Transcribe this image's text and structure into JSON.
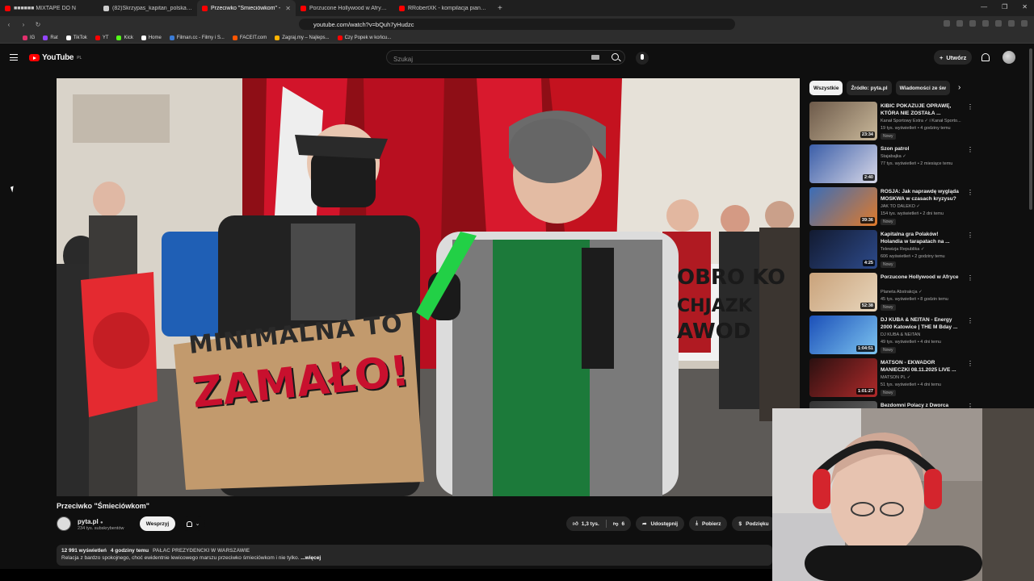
{
  "browser": {
    "tabs": [
      {
        "title": "■■■■■■ MIXTAPE DO N",
        "color": "#ff0000"
      },
      {
        "title": "(82)Skrzypas_kapitan_polska (@skrzy",
        "color": "#cccccc"
      },
      {
        "title": "Przeciwko \"Śmieciówkom\" -",
        "color": "#ff0000"
      },
      {
        "title": "Porzucone Hollywood w Afryce - Yo",
        "color": "#ff0000"
      },
      {
        "title": "RRobertXK - kompilacja pianek - Yo",
        "color": "#ff0000"
      }
    ],
    "url": "youtube.com/watch?v=bQuh7yHudzc",
    "bookmarks": [
      {
        "label": "IG",
        "color": "#e1306c"
      },
      {
        "label": "Rat",
        "color": "#9146ff"
      },
      {
        "label": "TikTok",
        "color": "#ffffff"
      },
      {
        "label": "YT",
        "color": "#ff0000"
      },
      {
        "label": "Kick",
        "color": "#53fc18"
      },
      {
        "label": "Home",
        "color": "#ffffff"
      },
      {
        "label": "Filman.cc - Filmy i S...",
        "color": "#3a7bd5"
      },
      {
        "label": "FACEIT.com",
        "color": "#ff5500"
      },
      {
        "label": "Zagraj.my – Najleps...",
        "color": "#ffb300"
      },
      {
        "label": "Czy Popek w końcu...",
        "color": "#ff0000"
      }
    ]
  },
  "header": {
    "logo": "YouTube",
    "region": "PL",
    "search_placeholder": "Szukaj",
    "create_label": "Utwórz"
  },
  "video": {
    "title": "Przeciwko \"Śmieciówkom\"",
    "channel": "pyta.pl",
    "subscribers": "234 tys. subskrybentów",
    "support_label": "Wesprzyj",
    "likes": "1,3 tys.",
    "dislikes": "6",
    "share_label": "Udostępnij",
    "download_label": "Pobierz",
    "thanks_label": "Podzięku",
    "views": "12 991 wyświetleń",
    "time_ago": "4 godziny temu",
    "location": "PAŁAC PREZYDENCKI W WARSZAWIE",
    "description": "Relacja z bardzo spokojnego, choć ewidentnie lewicowego marszu przeciwko śmieciówkom i nie tylko.",
    "more_label": "...więcej",
    "sign_line1": "MINIMALNA TO",
    "sign_line2": "ZAMAŁO!",
    "banner_line1": "OBRO KO",
    "banner_line2": "CHJAZK",
    "banner_line3": "AWOD"
  },
  "chips": [
    "Wszystkie",
    "Źródło: pyta.pl",
    "Wiadomości ze św"
  ],
  "recommendations": [
    {
      "title": "KIBIC POKAZUJE OPRAWĘ, KTÓRA NIE ZOSTAŁA ...",
      "channel": "Kanał Sportowy Extra ✓ i Kanał Sporto...",
      "meta": "19 tys. wyświetleń • 4 godziny temu",
      "badge": "Nowy",
      "duration": "23:34",
      "c1": "#6d5a4a",
      "c2": "#c9b89a"
    },
    {
      "title": "Szon patrol",
      "channel": "Stajabajka ✓",
      "meta": "77 tys. wyświetleń • 2 miesiące temu",
      "badge": "",
      "duration": "2:40",
      "c1": "#3b5ea8",
      "c2": "#d8d8e8"
    },
    {
      "title": "ROSJA: Jak naprawdę wygląda MOSKWA w czasach kryzysu? ...",
      "channel": "JAK TO DALEKO ✓",
      "meta": "154 tys. wyświetleń • 2 dni temu",
      "badge": "Nowy",
      "duration": "39:36",
      "c1": "#3a6db8",
      "c2": "#e07a2a"
    },
    {
      "title": "Kapitalna gra Polaków! Holandia w tarapatach na ...",
      "channel": "Telewizja Republika ✓",
      "meta": "606 wyświetleń • 2 godziny temu",
      "badge": "Nowy",
      "duration": "4:25",
      "c1": "#121a30",
      "c2": "#2d4a8a"
    },
    {
      "title": "Porzucone Hollywood w Afryce",
      "channel": "Planeta Abstrakcja ✓",
      "meta": "45 tys. wyświetleń • 8 godzin temu",
      "badge": "Nowy",
      "duration": "52:38",
      "c1": "#c9a27a",
      "c2": "#e8d6bc"
    },
    {
      "title": "DJ KUBA & NEITAN - Energy 2000 Katowice | THE M Bday ...",
      "channel": "DJ KUBA & NEITAN",
      "meta": "49 tys. wyświetleń • 4 dni temu",
      "badge": "Nowy",
      "duration": "1:04:51",
      "c1": "#1b4fb8",
      "c2": "#7cc4f0"
    },
    {
      "title": "MATSON - EKWADOR MANIECZKI 08.11.2025 LIVE ...",
      "channel": "MATSON PL ✓",
      "meta": "51 tys. wyświetleń • 4 dni temu",
      "badge": "Nowy",
      "duration": "1:01:27",
      "c1": "#2a1010",
      "c2": "#b02a2a"
    },
    {
      "title": "Bezdomni Polacy z Dworca ZOO ...",
      "channel": "",
      "meta": "",
      "badge": "",
      "duration": "",
      "c1": "#333333",
      "c2": "#666666"
    }
  ]
}
